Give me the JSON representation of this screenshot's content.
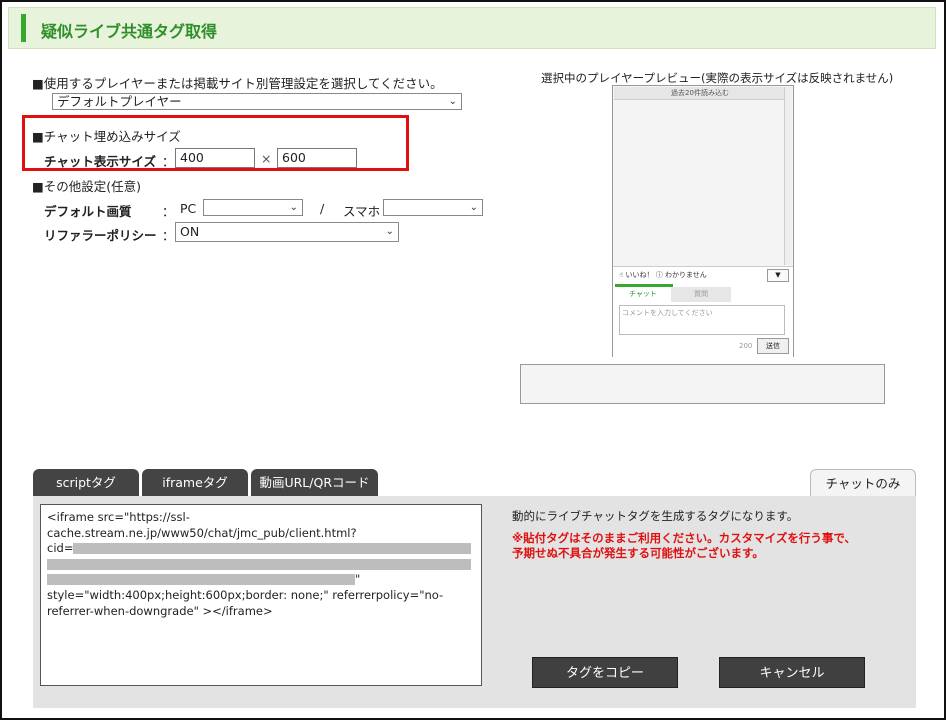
{
  "header": {
    "title": "疑似ライブ共通タグ取得"
  },
  "section1": {
    "label": "■使用するプレイヤーまたは掲載サイト別管理設定を選択してください。",
    "player_select": "デフォルトプレイヤー"
  },
  "chat_size": {
    "heading": "■チャット埋め込みサイズ",
    "label": "チャット表示サイズ",
    "colon": "：",
    "width": "400",
    "times": "×",
    "height": "600"
  },
  "other": {
    "heading": "■その他設定(任意)",
    "quality_label": "デフォルト画質",
    "colon": "：",
    "pc_label": "PC",
    "slash": "/",
    "sp_label": "スマホ",
    "pc_value": "",
    "sp_value": "",
    "referrer_label": "リファラーポリシー",
    "referrer_value": "ON"
  },
  "preview": {
    "label": "選択中のプレイヤープレビュー(実際の表示サイズは反映されません)",
    "load_past": "過去20件読み込む",
    "like": "いいね！",
    "dontknow": "わかりません",
    "tab_chat": "チャット",
    "tab_question": "質問",
    "comment_placeholder": "コメントを入力してください",
    "count": "200",
    "send": "送信"
  },
  "tabs": {
    "script": "scriptタグ",
    "iframe": "iframeタグ",
    "video": "動画URL/QRコード",
    "chat_only": "チャットのみ"
  },
  "code": {
    "line1": "<iframe src=\"https://ssl-",
    "line2": "cache.stream.ne.jp/www50/chat/jmc_pub/client.html?",
    "line3": "cid=",
    "line4_end": "\"",
    "line5": " style=\"width:400px;height:600px;border: none;\" referrerpolicy=\"no-",
    "line6": "referrer-when-downgrade\" ></iframe>"
  },
  "description": "動的にライブチャットタグを生成するタグになります。",
  "warning_line1": "※貼付タグはそのままご利用ください。カスタマイズを行う事で、",
  "warning_line2": "予期せぬ不具合が発生する可能性がございます。",
  "buttons": {
    "copy": "タグをコピー",
    "cancel": "キャンセル"
  },
  "colors": {
    "accent_green": "#37a82c",
    "highlight_red": "#e01010",
    "tab_dark": "#444444"
  }
}
